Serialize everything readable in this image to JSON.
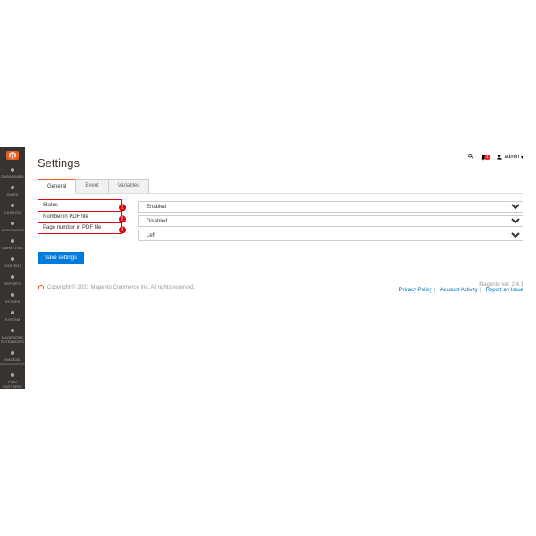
{
  "page": {
    "title": "Settings"
  },
  "topbar": {
    "notif_count": "1",
    "user": "admin"
  },
  "sidebar": {
    "items": [
      {
        "label": "DASHBOARD",
        "name": "dashboard"
      },
      {
        "label": "SALES",
        "name": "sales"
      },
      {
        "label": "CATALOG",
        "name": "catalog"
      },
      {
        "label": "CUSTOMERS",
        "name": "customers"
      },
      {
        "label": "MARKETING",
        "name": "marketing"
      },
      {
        "label": "CONTENT",
        "name": "content"
      },
      {
        "label": "REPORTS",
        "name": "reports"
      },
      {
        "label": "STORES",
        "name": "stores"
      },
      {
        "label": "SYSTEM",
        "name": "system"
      },
      {
        "label": "MAGEWORX EXTENSIONS",
        "name": "mageworx"
      },
      {
        "label": "MAGEZA DIAGNOSTICS",
        "name": "mageza"
      },
      {
        "label": "FIND PARTNERS",
        "name": "partners"
      }
    ]
  },
  "tabs": [
    {
      "label": "General",
      "active": true
    },
    {
      "label": "Event"
    },
    {
      "label": "Variables"
    }
  ],
  "form": {
    "rows": [
      {
        "label": "Status",
        "value": "Enabled",
        "marker": "1"
      },
      {
        "label": "Number in PDF file",
        "value": "Disabled",
        "marker": "2"
      },
      {
        "label": "Page number in PDF file",
        "value": "Left",
        "marker": "3"
      }
    ],
    "save_label": "Save settings"
  },
  "footer": {
    "copyright": "Copyright © 2021 Magento Commerce Inc. All rights reserved.",
    "version": "Magento ver. 2.4.1",
    "links": [
      {
        "label": "Privacy Policy"
      },
      {
        "label": "Account Activity"
      },
      {
        "label": "Report an Issue"
      }
    ]
  }
}
